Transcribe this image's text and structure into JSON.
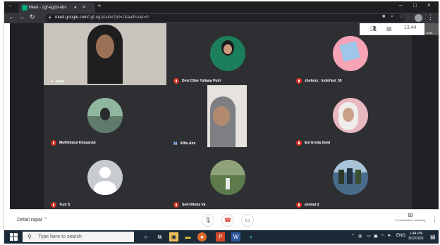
{
  "browser": {
    "tab_title": "Meet - zgf-egzd-ebv",
    "tab_status": "●",
    "close_label": "×",
    "new_tab_label": "+",
    "minimize_label": "–",
    "maximize_label": "□",
    "window_close_label": "×",
    "url_host": "meet.google.com",
    "url_path": "/zgf-egzd-ebv?pli=1&authuser=0"
  },
  "meet": {
    "time": "13.44",
    "pip_name": "Anda",
    "participants": [
      {
        "name": "Anda",
        "indicator": "dots",
        "kind": "video"
      },
      {
        "name": "Devi Clise Yuliana Putri",
        "indicator": "mic-off",
        "kind": "avatar",
        "bg": "#1b7f5b"
      },
      {
        "name": "zholiesz_ IndaYani_59",
        "indicator": "mic-off",
        "kind": "avatar",
        "bg": "#f5a3b5"
      },
      {
        "name": "Muflikhatul Khasanah",
        "indicator": "mic-off",
        "kind": "avatar",
        "bg": "#8fb7a0"
      },
      {
        "name": "Afifa Aini",
        "indicator": "speaking",
        "kind": "video"
      },
      {
        "name": "Eni Ervita Dewi",
        "indicator": "mic-off",
        "kind": "avatar",
        "bg": "#e8b8c0"
      },
      {
        "name": "Yuni S",
        "indicator": "mic-off",
        "kind": "avatar",
        "bg": "#c8ccd0"
      },
      {
        "name": "Serli Rinda Va",
        "indicator": "mic-off",
        "kind": "avatar",
        "bg": "#5d7a4a"
      },
      {
        "name": "ahmad d",
        "indicator": "mic-off",
        "kind": "avatar",
        "bg": "#4a6a8a"
      }
    ],
    "bottom": {
      "detail_label": "Detail rapat",
      "present_label": "Presentasikan sekarang"
    }
  },
  "taskbar": {
    "search_placeholder": "Type here to search",
    "lang": "ENG",
    "clock_time": "1:44 PM",
    "clock_date": "3/22/2021"
  },
  "colors": {
    "stage_bg": "#202124",
    "mic_off": "#d93025",
    "hangup": "#d93025"
  }
}
